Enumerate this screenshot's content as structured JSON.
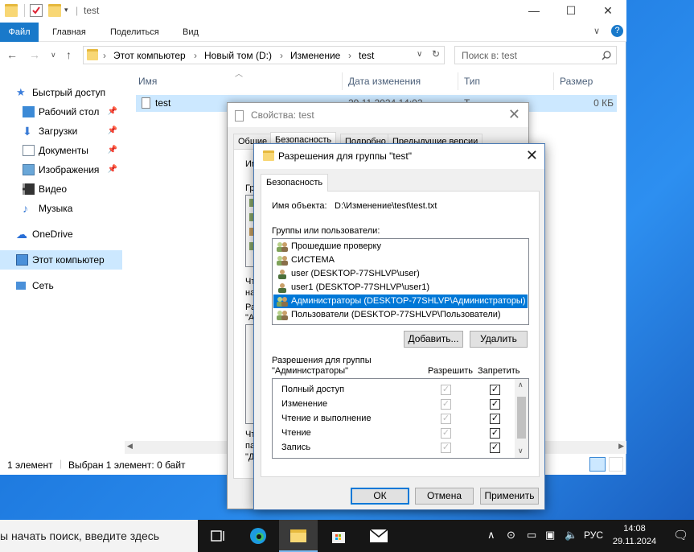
{
  "explorer": {
    "title": "test",
    "ribbon_tabs": [
      "Файл",
      "Главная",
      "Поделиться",
      "Вид"
    ],
    "breadcrumbs": [
      "Этот компьютер",
      "Новый том (D:)",
      "Изменение",
      "test"
    ],
    "search_placeholder": "Поиск в: test",
    "nav": [
      {
        "label": "Быстрый доступ",
        "icon": "star-icon"
      },
      {
        "label": "Рабочий стол",
        "icon": "desktop-icon"
      },
      {
        "label": "Загрузки",
        "icon": "download-icon"
      },
      {
        "label": "Документы",
        "icon": "documents-icon"
      },
      {
        "label": "Изображения",
        "icon": "pictures-icon"
      },
      {
        "label": "Видео",
        "icon": "video-icon"
      },
      {
        "label": "Музыка",
        "icon": "music-icon"
      },
      {
        "label": "OneDrive",
        "icon": "cloud-icon"
      },
      {
        "label": "Этот компьютер",
        "icon": "computer-icon"
      },
      {
        "label": "Сеть",
        "icon": "network-icon"
      }
    ],
    "columns": [
      "Имя",
      "Дата изменения",
      "Тип",
      "Размер"
    ],
    "file": {
      "name": "test",
      "date": "29.11.2024 14:02",
      "type": "Т",
      "size": "0 КБ"
    },
    "status_count": "1 элемент",
    "status_selected": "Выбран 1 элемент: 0 байт"
  },
  "props": {
    "title": "Свойства: test",
    "tabs": [
      "Общие",
      "Безопасность",
      "Подробно",
      "Предыдущие версии"
    ],
    "clipped": {
      "imya": "Имя",
      "gr": "Груп",
      "cht": "Чтс",
      "na": "на",
      "ra": "Ра",
      "a": "\"А",
      "cht2": "Чт",
      "pa": "па",
      "d": "\"Д"
    }
  },
  "perm": {
    "title": "Разрешения для группы \"test\"",
    "tab": "Безопасность",
    "object_label": "Имя объекта:",
    "object_value": "D:\\Изменение\\test\\test.txt",
    "groups_label": "Группы или пользователи:",
    "groups": [
      "Прошедшие проверку",
      "СИСТЕМА",
      "user (DESKTOP-77SHLVP\\user)",
      "user1 (DESKTOP-77SHLVP\\user1)",
      "Администраторы (DESKTOP-77SHLVP\\Администраторы)",
      "Пользователи (DESKTOP-77SHLVP\\Пользователи)"
    ],
    "add_button": "Добавить...",
    "remove_button": "Удалить",
    "perms_label_1": "Разрешения для группы",
    "perms_label_2": "\"Администраторы\"",
    "allow_header": "Разрешить",
    "deny_header": "Запретить",
    "permissions": [
      "Полный доступ",
      "Изменение",
      "Чтение и выполнение",
      "Чтение",
      "Запись"
    ],
    "ok_button": "ОК",
    "cancel_button": "Отмена",
    "apply_button": "Применить"
  },
  "taskbar": {
    "search_text": "ы начать поиск, введите здесь",
    "language": "РУС",
    "time": "14:08",
    "date": "29.11.2024"
  }
}
